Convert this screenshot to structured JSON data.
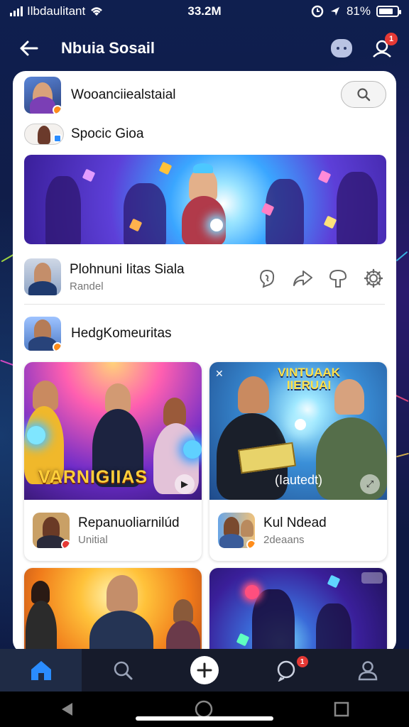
{
  "status_bar": {
    "carrier": "Ilbdaulitant",
    "time": "33.2M",
    "battery": "81%",
    "battery_level": 0.81
  },
  "header": {
    "title": "Nbuia Sosail",
    "notification_count": "1"
  },
  "profile": {
    "name": "Wooanciiealstaial"
  },
  "search": {
    "icon": "search-icon"
  },
  "story": {
    "label": "Spocic Gioa"
  },
  "post": {
    "author": "Plohnuni Iitas Siala",
    "subtitle": "Randel"
  },
  "community": {
    "label": "HedgKomeuritas"
  },
  "tiles": [
    {
      "overlay": "VARNIGIIAS",
      "author": "Repanuoliarnilúd",
      "meta": "Unitial"
    },
    {
      "overlay_top": "VINTUAAK\nIIERUAI",
      "overlay_mid": "(Iautedt)",
      "author": "Kul Ndead",
      "meta": "2deaans"
    }
  ],
  "bottom_nav": {
    "items": [
      "home",
      "search",
      "create",
      "notifications",
      "profile"
    ],
    "notification_count": "1"
  },
  "colors": {
    "accent": "#2a8cff",
    "badge": "#e53935",
    "nav_bg": "#161b2b"
  }
}
